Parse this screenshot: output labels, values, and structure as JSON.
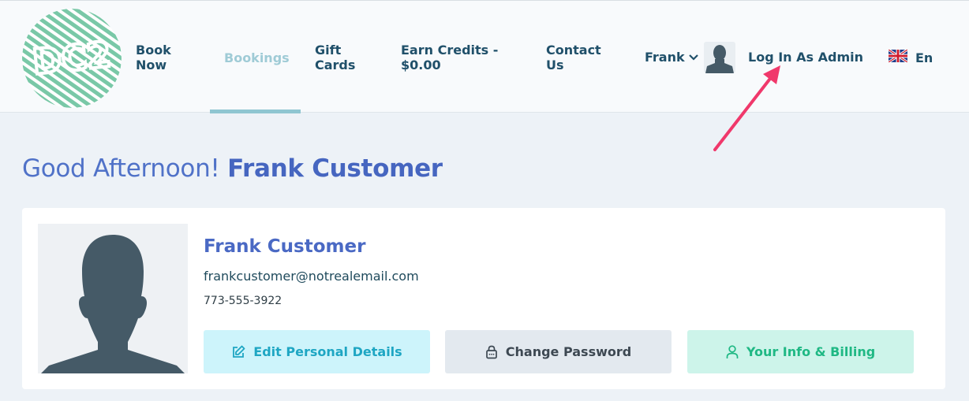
{
  "header": {
    "logo_text": "DC2",
    "nav": [
      {
        "label_line1": "Book",
        "label_line2": "Now"
      },
      {
        "label": "Bookings"
      },
      {
        "label_line1": "Gift",
        "label_line2": "Cards"
      },
      {
        "label_line1": "Earn Credits -",
        "label_line2": "$0.00"
      },
      {
        "label_line1": "Contact",
        "label_line2": "Us"
      }
    ],
    "user_menu": "Frank",
    "user_menu_icon": "chevron-down-icon",
    "admin_link": "Log In As Admin",
    "language": "En",
    "language_icon": "uk-flag-icon"
  },
  "greeting": {
    "prefix": "Good Afternoon!",
    "name": "Frank Customer"
  },
  "profile": {
    "name": "Frank Customer",
    "email": "frankcustomer@notrealemail.com",
    "phone": "773-555-3922",
    "buttons": {
      "edit": "Edit Personal Details",
      "password": "Change Password",
      "billing": "Your Info & Billing"
    }
  },
  "colors": {
    "accent": "#4a69c4",
    "nav_text": "#20506a",
    "arrow": "#f0386b"
  }
}
